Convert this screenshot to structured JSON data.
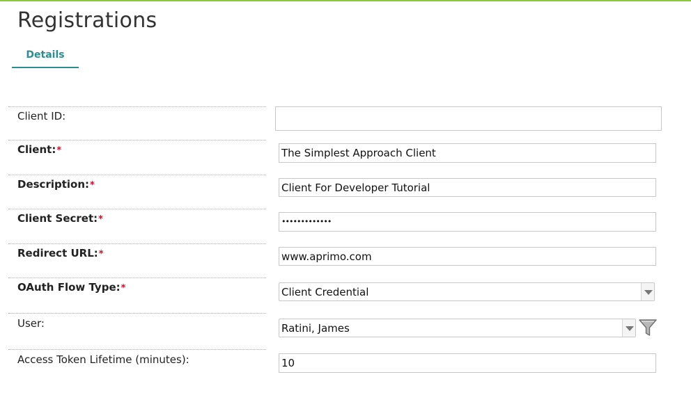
{
  "page": {
    "title": "Registrations"
  },
  "tabs": [
    {
      "label": "Details"
    }
  ],
  "fields": {
    "client_id": {
      "label": "Client ID:",
      "value": ""
    },
    "client": {
      "label": "Client:",
      "value": "The Simplest Approach Client",
      "required_mark": "*"
    },
    "description": {
      "label": "Description:",
      "value": "Client For Developer Tutorial",
      "required_mark": "*"
    },
    "client_secret": {
      "label": "Client Secret:",
      "value": "•••••••••••••",
      "required_mark": "*"
    },
    "redirect_url": {
      "label": "Redirect URL:",
      "value": "www.aprimo.com",
      "required_mark": "*"
    },
    "oauth_flow_type": {
      "label": "OAuth Flow Type:",
      "value": "Client Credential",
      "required_mark": "*"
    },
    "user": {
      "label": "User:",
      "value": "Ratini, James"
    },
    "access_token_lifetime": {
      "label": "Access Token Lifetime (minutes):",
      "value": "10"
    }
  },
  "icons": {
    "user_filter": "funnel-icon",
    "dropdown": "chevron-down-icon"
  },
  "colors": {
    "accent": "#2a8d8f",
    "top_bar": "#8dc63f",
    "required": "#c8102e"
  }
}
